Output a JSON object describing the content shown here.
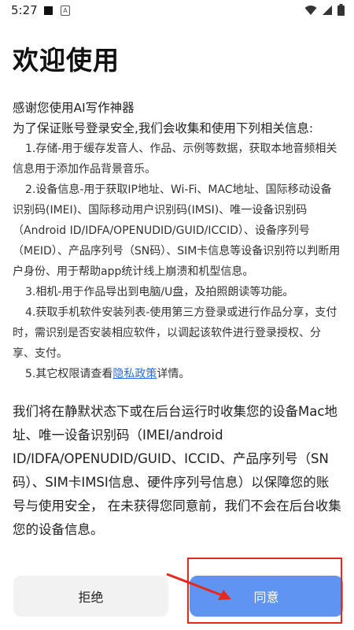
{
  "status": {
    "time": "5:27"
  },
  "title": "欢迎使用",
  "intro": {
    "thanks": "感谢您使用AI写作神器",
    "purpose": "为了保证账号登录安全,我们会收集和使用下列相关信息:"
  },
  "permissions": [
    "1.存储-用于缓存发音人、作品、示例等数据，获取本地音频相关信息用于添加作品背景音乐。",
    "2.设备信息-用于获取IP地址、Wi-Fi、MAC地址、国际移动设备识别码(IMEI)、国际移动用户识别码(IMSI)、唯一设备识别码（Android ID/IDFA/OPENUDID/GUID/ICCID）、设备序列号（MEID）、产品序列号（SN码）、SIM卡信息等设备识别符以判断用户身份、用于帮助app统计线上崩溃和机型信息。",
    "3.相机-用于作品导出到电脑/U盘，及拍照朗读等功能。",
    "4.获取手机软件安装列表-使用第三方登录或进行作品分享，支付时，需识别是否安装相应软件，以调起该软件进行登录授权、分享、支付。"
  ],
  "perm5": {
    "prefix": "5.其它权限请查看",
    "link": "隐私政策",
    "suffix": "详情。"
  },
  "notice": "我们将在静默状态下或在后台运行时收集您的设备Mac地址、唯一设备识别码（IMEI/android ID/IDFA/OPENUDID/GUID、ICCID、产品序列号（SN码）、SIM卡IMSI信息、硬件序列号信息）以保障您的账号与使用安全， 在未获得您同意前，我们不会在后台收集您的设备信息。",
  "buttons": {
    "decline": "拒绝",
    "agree": "同意"
  },
  "colors": {
    "agree_bg": "#5f94f3",
    "link": "#2b6de8",
    "annotation": "#e8281c"
  }
}
